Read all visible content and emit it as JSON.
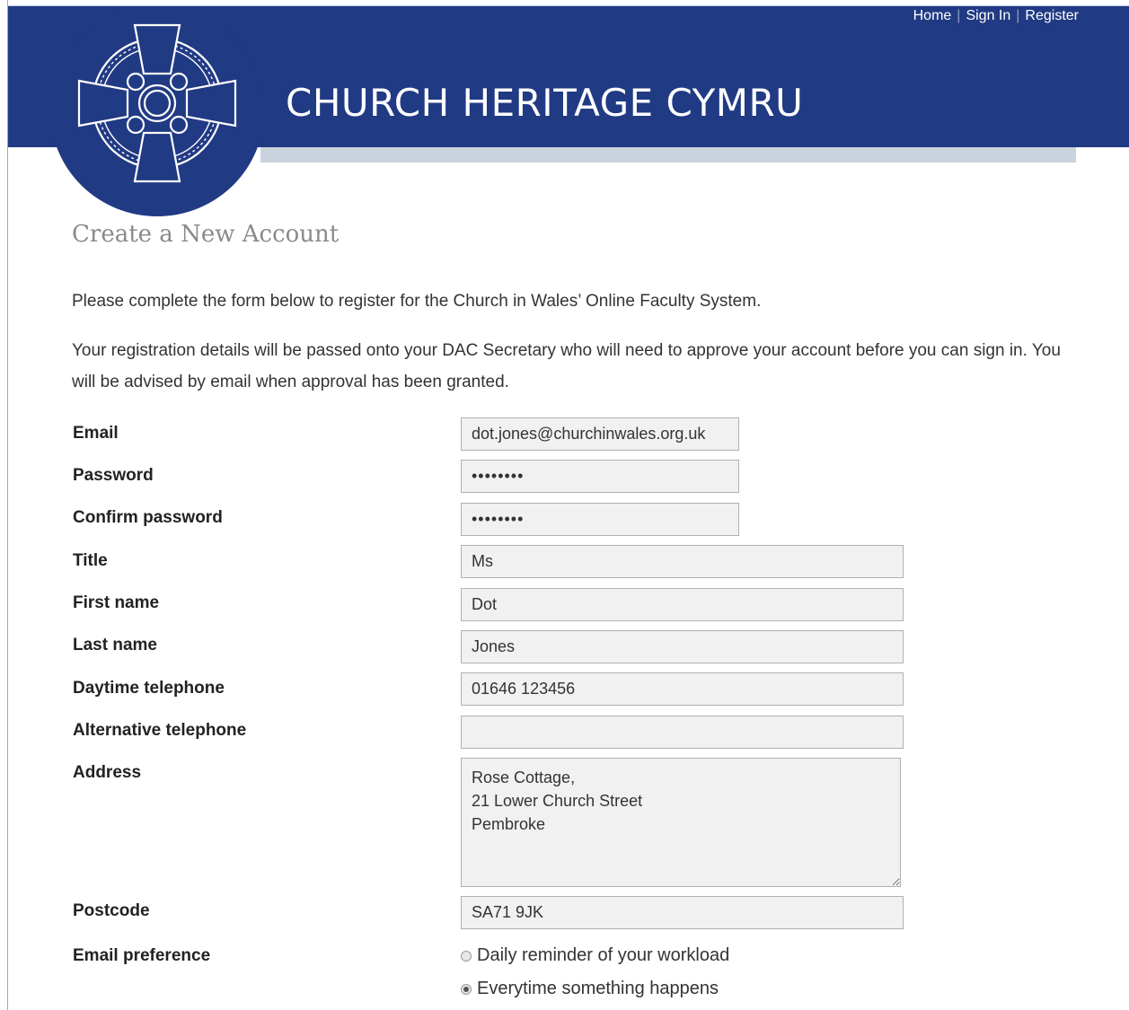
{
  "header": {
    "site_title": "CHURCH HERITAGE CYMRU",
    "nav": [
      "Home",
      "Sign In",
      "Register"
    ]
  },
  "page": {
    "heading": "Create a New Account",
    "intro_1": "Please complete the form below to register for the Church in Wales’ Online Faculty System.",
    "intro_2": "Your registration details will be passed onto your DAC Secretary who will need to approve your account before you can sign in. You will be advised by email when approval has been granted."
  },
  "form": {
    "email": {
      "label": "Email",
      "value": "dot.jones@churchinwales.org.uk"
    },
    "password": {
      "label": "Password",
      "value": "••••••••"
    },
    "confirm_password": {
      "label": "Confirm password",
      "value": "••••••••"
    },
    "title": {
      "label": "Title",
      "value": "Ms"
    },
    "first_name": {
      "label": "First name",
      "value": "Dot"
    },
    "last_name": {
      "label": "Last name",
      "value": "Jones"
    },
    "daytime_telephone": {
      "label": "Daytime telephone",
      "value": "01646 123456"
    },
    "alternative_telephone": {
      "label": "Alternative telephone",
      "value": ""
    },
    "address": {
      "label": "Address",
      "value": "Rose Cottage,\n21 Lower Church Street\nPembroke"
    },
    "postcode": {
      "label": "Postcode",
      "value": "SA71 9JK"
    },
    "email_preference": {
      "label": "Email preference",
      "options": [
        "Daily reminder of your workload",
        "Everytime something happens"
      ],
      "selected": "Everytime something happens"
    }
  },
  "colors": {
    "banner": "#213a84",
    "band": "#c9d3de",
    "field_bg": "#f1f1f1"
  }
}
